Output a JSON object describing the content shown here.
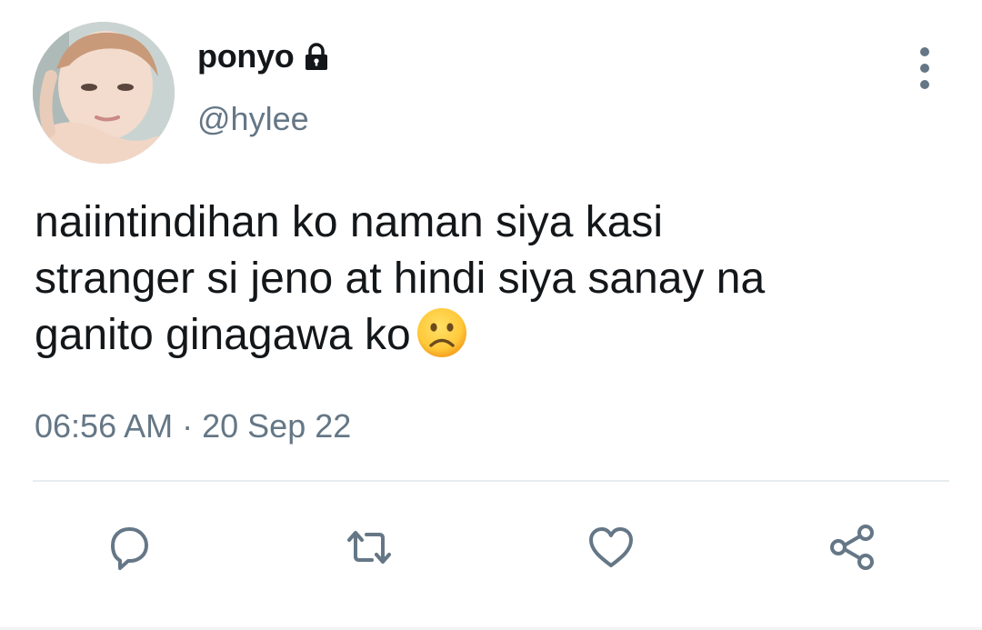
{
  "author": {
    "display_name": "ponyo",
    "handle": "@hylee",
    "protected_icon": "lock-icon",
    "avatar": "avatar-photo"
  },
  "tweet": {
    "text_lines": [
      "naiintindihan ko naman siya kasi",
      "stranger si jeno at hindi siya sanay na",
      "ganito ginagawa ko"
    ],
    "emoji": "frowning-face-emoji",
    "time": "06:56 AM",
    "separator": "·",
    "date": "20 Sep 22"
  },
  "actions": {
    "reply_icon": "reply-icon",
    "retweet_icon": "retweet-icon",
    "like_icon": "heart-icon",
    "share_icon": "share-icon",
    "more_icon": "more-vertical-icon"
  },
  "colors": {
    "text": "#14171a",
    "secondary": "#657786",
    "divider": "#e6ecf0",
    "icon": "#657786"
  }
}
